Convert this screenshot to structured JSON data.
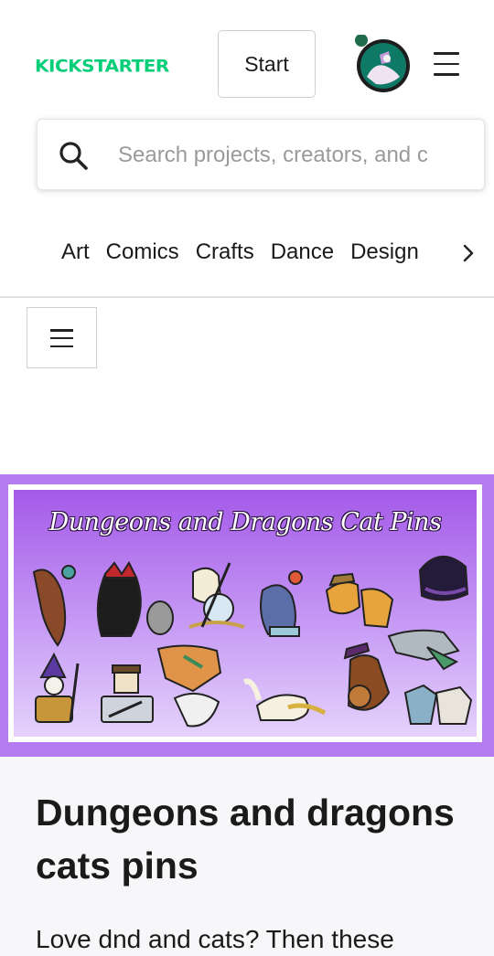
{
  "brand": {
    "logo_text": "KICKSTARTER",
    "accent_color": "#05ce78"
  },
  "header": {
    "start_label": "Start",
    "avatar_icon": "user-avatar",
    "menu_icon": "hamburger-menu-icon"
  },
  "search": {
    "placeholder": "Search projects, creators, and c",
    "icon": "search-icon"
  },
  "categories": {
    "items": [
      "Art",
      "Comics",
      "Crafts",
      "Dance",
      "Design"
    ],
    "next_icon": "chevron-right-icon"
  },
  "secondary_menu": {
    "icon": "hamburger-menu-icon"
  },
  "hero": {
    "banner_text": "Dungeons and Dragons Cat Pins",
    "background_color": "#b57bf0"
  },
  "project": {
    "title": "Dungeons and dragons cats pins",
    "blurb": "Love dnd and cats? Then these"
  }
}
